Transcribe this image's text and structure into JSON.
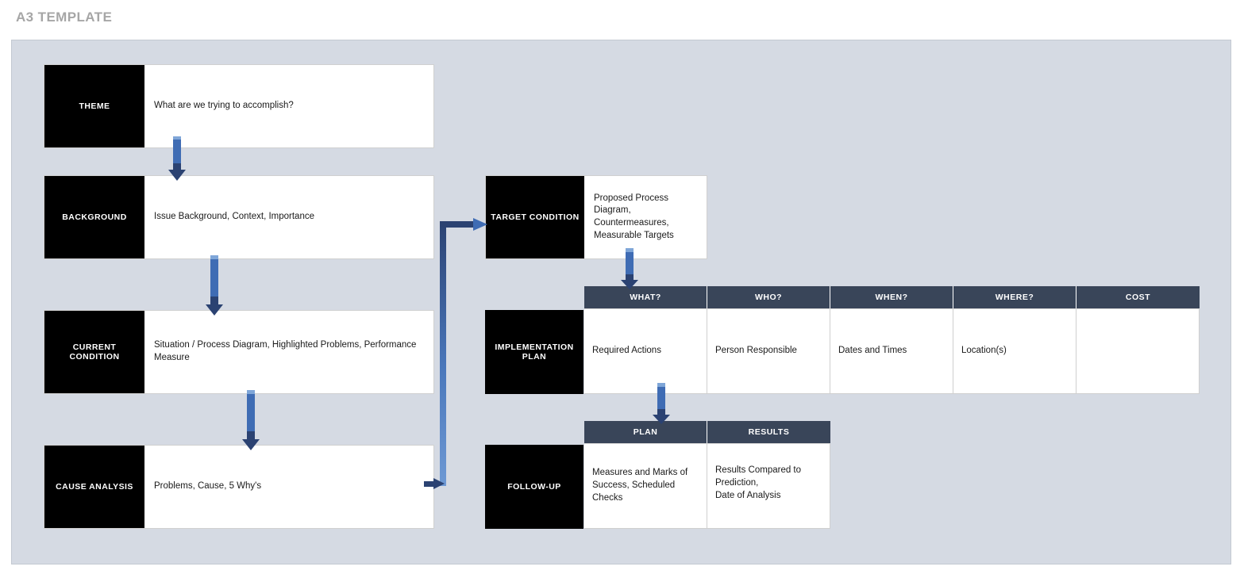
{
  "page": {
    "title": "A3 TEMPLATE"
  },
  "colors": {
    "canvas_bg": "#d5dae3",
    "label_bg": "#000000",
    "table_header_bg": "#394559",
    "arrow_shaft": "#3f6cb4",
    "arrow_head": "#2b4272",
    "title_text": "#a6a6a6"
  },
  "left_column": {
    "blocks": [
      {
        "label": "THEME",
        "body": "What are we trying to accomplish?"
      },
      {
        "label": "BACKGROUND",
        "body": "Issue Background, Context, Importance"
      },
      {
        "label": "CURRENT CONDITION",
        "body": "Situation / Process Diagram, Highlighted Problems, Performance Measure"
      },
      {
        "label": "CAUSE ANALYSIS",
        "body": "Problems, Cause, 5 Why's"
      }
    ]
  },
  "right_column": {
    "target_condition": {
      "label": "TARGET CONDITION",
      "body": "Proposed Process Diagram,\nCountermeasures,\nMeasurable Targets"
    },
    "implementation_plan": {
      "label": "IMPLEMENTATION PLAN",
      "headers": [
        "WHAT?",
        "WHO?",
        "WHEN?",
        "WHERE?",
        "COST"
      ],
      "row": [
        "Required Actions",
        "Person Responsible",
        "Dates and Times",
        "Location(s)",
        ""
      ]
    },
    "follow_up": {
      "label": "FOLLOW-UP",
      "headers": [
        "PLAN",
        "RESULTS"
      ],
      "row": [
        "Measures and Marks of\nSuccess, Scheduled Checks",
        "Results Compared to\nPrediction,\nDate of Analysis"
      ]
    }
  },
  "arrows": {
    "theme_to_background": "down-arrow",
    "background_to_current": "down-arrow",
    "current_to_cause": "down-arrow",
    "cause_to_target": "elbow-arrow-up-right",
    "target_to_what": "down-arrow",
    "implementation_to_plan": "down-arrow"
  }
}
